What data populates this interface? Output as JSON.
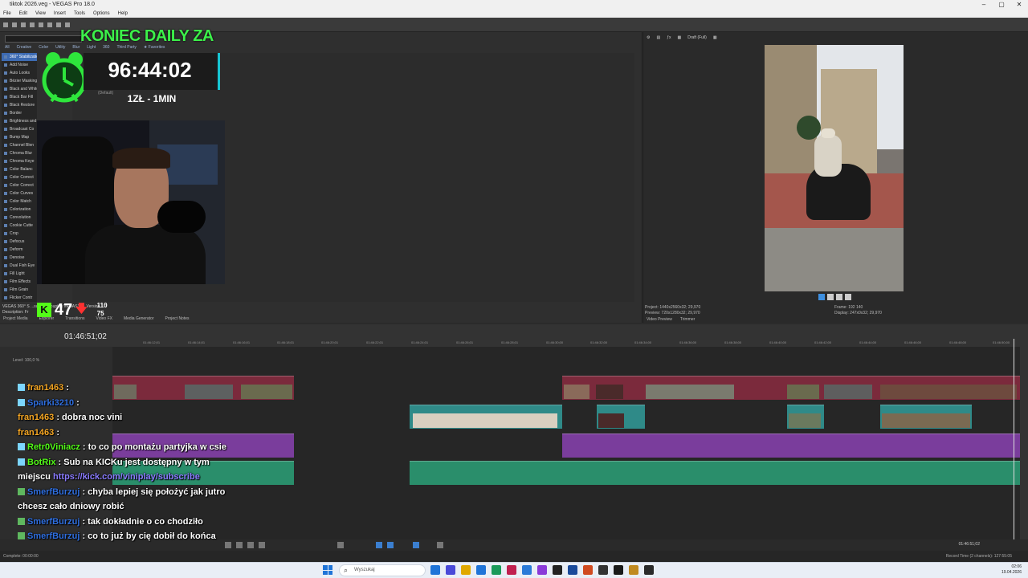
{
  "window": {
    "title": "tiktok 2026.veg - VEGAS Pro 18.0",
    "controls": [
      "–",
      "▢",
      "✕"
    ]
  },
  "menu": [
    "File",
    "Edit",
    "View",
    "Insert",
    "Tools",
    "Options",
    "Help"
  ],
  "fx": {
    "tabs": [
      "All",
      "Creative",
      "Color",
      "Utility",
      "Blur",
      "Light",
      "360",
      "Third Party",
      "★ Favorites"
    ],
    "items": [
      "360° Stabilization",
      "Add Noise",
      "Auto Looks",
      "Bézier Masking",
      "Black and White",
      "Black Bar Fill",
      "Black Restore",
      "Border",
      "Brightness and",
      "Broadcast Co",
      "Bump Map",
      "Channel Blen",
      "Chroma Blur",
      "Chroma Keye",
      "Color Balanc",
      "Color Correct",
      "Color Correct",
      "Color Curves",
      "Color Match",
      "Colorization",
      "Convolution",
      "Cookie Cutte",
      "Crop",
      "Defocus",
      "Deform",
      "Denoise",
      "Dual Fish Eye",
      "Fill Light",
      "Film Effects",
      "Film Grain",
      "Flicker Contr"
    ],
    "info_line1": "VEGAS 360° S   ...sated, Grouping VEGAS360, Version 1.0",
    "info_line2": "Description: Fr",
    "panel_tabs": [
      "Project Media",
      "Explorer",
      "Transitions",
      "Video FX",
      "Media Generator",
      "Project Notes"
    ]
  },
  "overlay": {
    "title": "KONIEC DAILY ZA",
    "timer": "96:44:02",
    "rate": "1ZŁ - 1MIN",
    "default_tag": "(Default)"
  },
  "kick": {
    "logo": "K",
    "viewers": "47",
    "arrow": "🡇",
    "stat_a": "110",
    "stat_b": "75"
  },
  "preview": {
    "toolbar": [
      "⚙",
      "▤",
      "ƒx",
      "▦",
      "Draft (Full)",
      "▦"
    ],
    "project_line": "Project:  1440x2560x32; 29,970",
    "preview_line": "Preview: 720x1280x32; 29,970",
    "frame_line": "Frame:     192 140",
    "display_line": "Display:   247x0x32; 29,970",
    "tabs": [
      "Video Preview",
      "Trimmer"
    ]
  },
  "timeline": {
    "time": "01:46:51;02",
    "ruler": [
      "01:46:12;01",
      "01:46:14;01",
      "01:46:16;01",
      "01:46:18;01",
      "01:46:20;01",
      "01:46:22;01",
      "01:46:24;01",
      "01:46:26;01",
      "01:46:28;01",
      "01:46:30;00",
      "01:46:32;00",
      "01:46:34;00",
      "01:46:36;00",
      "01:46:38;00",
      "01:46:40;00",
      "01:46:42;00",
      "01:46:44;00",
      "01:46:46;00",
      "01:46:48;00",
      "01:46:50;00"
    ],
    "level_label": "Level: 100,0 %",
    "end_time": "01:46:51;02",
    "status_left": "Complete: 00:00:00",
    "status_right": "Record Time (2 channels): 127:55:05"
  },
  "chat": [
    {
      "user": "fran1463",
      "user_color": "#f5a623",
      "text": " :",
      "badge": "#7cd6ff"
    },
    {
      "user": "Sparki3210",
      "user_color": "#2f6fe0",
      "text": " :",
      "badge": "#7cd6ff"
    },
    {
      "user": "fran1463",
      "user_color": "#f5a623",
      "text": " : dobra noc vini",
      "badge": ""
    },
    {
      "user": "fran1463",
      "user_color": "#f5a623",
      "text": " :",
      "badge": ""
    },
    {
      "user": "Retr0Viniacz",
      "user_color": "#53fc18",
      "text": " : to co po montażu partyjka w csie",
      "badge": "#7cd6ff"
    },
    {
      "user": "BotRix",
      "user_color": "#53fc18",
      "text": " : Sub na KICKu jest dostępny w tym miejscu ",
      "badge": "#7cd6ff",
      "link": "https://kick.com/viniplay/subscribe"
    },
    {
      "user": "SmerfBurzuj",
      "user_color": "#2f6fe0",
      "text": " : chyba lepiej się położyć jak jutro chcesz cało dniowy robić",
      "badge": "#5fb85f"
    },
    {
      "user": "SmerfBurzuj",
      "user_color": "#2f6fe0",
      "text": " : tak dokładnie o co chodziło",
      "badge": "#5fb85f"
    },
    {
      "user": "SmerfBurzuj",
      "user_color": "#2f6fe0",
      "text": " : co to już by cię dobił do końca",
      "badge": "#5fb85f"
    }
  ],
  "taskbar": {
    "search_placeholder": "Wyszukaj",
    "time": "02:06",
    "date": "19.04.2026",
    "app_colors": [
      "#1f74d8",
      "#4a4ad8",
      "#e0a800",
      "#1f74d8",
      "#1a9a5a",
      "#0a6aa0",
      "#c02050",
      "#2a7ad8",
      "#8a3ad8",
      "#222",
      "#1a4a9a",
      "#d04a20",
      "#333",
      "#1a1a1a",
      "#c08a20",
      "#2a2a2a"
    ]
  }
}
